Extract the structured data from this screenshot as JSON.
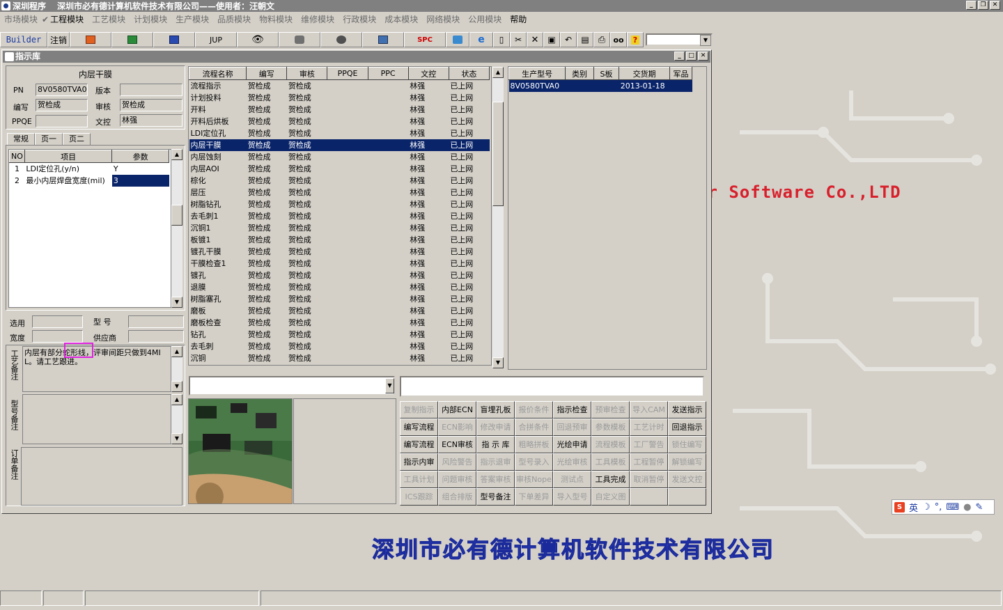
{
  "app": {
    "title": "深圳程序",
    "company_title": "深圳市必有德计算机软件技术有限公司——使用者：汪朝文"
  },
  "menu": [
    {
      "label": "市场模块",
      "active": false
    },
    {
      "label": "工程模块",
      "active": true
    },
    {
      "label": "工艺模块",
      "active": false
    },
    {
      "label": "计划模块",
      "active": false
    },
    {
      "label": "生产模块",
      "active": false
    },
    {
      "label": "品质模块",
      "active": false
    },
    {
      "label": "物料模块",
      "active": false
    },
    {
      "label": "维修模块",
      "active": false
    },
    {
      "label": "行政模块",
      "active": false
    },
    {
      "label": "成本模块",
      "active": false
    },
    {
      "label": "网络模块",
      "active": false
    },
    {
      "label": "公用模块",
      "active": false
    },
    {
      "label": "帮助",
      "active": true
    }
  ],
  "toolbar": {
    "builder": "Builder",
    "logout": "注销",
    "jup": "JUP",
    "spc": "SPC"
  },
  "desktop": {
    "watermark": "er Software Co.,LTD",
    "company": "深圳市必有德计算机软件技术有限公司"
  },
  "ime": {
    "label": "英"
  },
  "window": {
    "title": "指示库"
  },
  "left": {
    "section_title": "内层干膜",
    "pn_label": "PN",
    "pn_value": "8V0580TVA0",
    "version_label": "版本",
    "version_value": "",
    "author_label": "编写",
    "author_value": "贺检成",
    "reviewer_label": "审核",
    "reviewer_value": "贺检成",
    "ppqe_label": "PPQE",
    "ppqe_value": "",
    "doc_label": "文控",
    "doc_value": "林强",
    "tabs": [
      "常规",
      "页一",
      "页二"
    ],
    "param_headers": [
      "NO",
      "项目",
      "参数"
    ],
    "params": [
      {
        "no": "1",
        "item": "LDI定位孔(y/n)",
        "value": "Y"
      },
      {
        "no": "2",
        "item": "最小内层焊盘宽度(mil)",
        "value": "3"
      }
    ],
    "select_label": "选用",
    "model_label": "型 号",
    "width_label": "宽度",
    "supplier_label": "供应商",
    "process_note_label": "工艺备注",
    "process_note": "内层有部分蛇形线，评审间距只做到4MIL。请工艺跟进。",
    "model_note_label": "型号备注",
    "order_note_label": "订单备注"
  },
  "process_table": {
    "headers": [
      "流程名称",
      "编写",
      "审核",
      "PPQE",
      "PPC",
      "文控",
      "状态"
    ],
    "rows": [
      {
        "name": "流程指示",
        "author": "贺检成",
        "reviewer": "贺检成",
        "ppqe": "",
        "ppc": "",
        "doc": "林强",
        "status": "已上网"
      },
      {
        "name": "计划投料",
        "author": "贺检成",
        "reviewer": "贺检成",
        "ppqe": "",
        "ppc": "",
        "doc": "林强",
        "status": "已上网"
      },
      {
        "name": "开料",
        "author": "贺检成",
        "reviewer": "贺检成",
        "ppqe": "",
        "ppc": "",
        "doc": "林强",
        "status": "已上网"
      },
      {
        "name": "开料后烘板",
        "author": "贺检成",
        "reviewer": "贺检成",
        "ppqe": "",
        "ppc": "",
        "doc": "林强",
        "status": "已上网"
      },
      {
        "name": "LDI定位孔",
        "author": "贺检成",
        "reviewer": "贺检成",
        "ppqe": "",
        "ppc": "",
        "doc": "林强",
        "status": "已上网"
      },
      {
        "name": "内层干膜",
        "author": "贺检成",
        "reviewer": "贺检成",
        "ppqe": "",
        "ppc": "",
        "doc": "林强",
        "status": "已上网",
        "selected": true
      },
      {
        "name": "内层蚀刻",
        "author": "贺检成",
        "reviewer": "贺检成",
        "ppqe": "",
        "ppc": "",
        "doc": "林强",
        "status": "已上网"
      },
      {
        "name": "内层AOI",
        "author": "贺检成",
        "reviewer": "贺检成",
        "ppqe": "",
        "ppc": "",
        "doc": "林强",
        "status": "已上网"
      },
      {
        "name": "棕化",
        "author": "贺检成",
        "reviewer": "贺检成",
        "ppqe": "",
        "ppc": "",
        "doc": "林强",
        "status": "已上网"
      },
      {
        "name": "层压",
        "author": "贺检成",
        "reviewer": "贺检成",
        "ppqe": "",
        "ppc": "",
        "doc": "林强",
        "status": "已上网"
      },
      {
        "name": "树脂钻孔",
        "author": "贺检成",
        "reviewer": "贺检成",
        "ppqe": "",
        "ppc": "",
        "doc": "林强",
        "status": "已上网"
      },
      {
        "name": "去毛刺1",
        "author": "贺检成",
        "reviewer": "贺检成",
        "ppqe": "",
        "ppc": "",
        "doc": "林强",
        "status": "已上网"
      },
      {
        "name": "沉铜1",
        "author": "贺检成",
        "reviewer": "贺检成",
        "ppqe": "",
        "ppc": "",
        "doc": "林强",
        "status": "已上网"
      },
      {
        "name": "板镀1",
        "author": "贺检成",
        "reviewer": "贺检成",
        "ppqe": "",
        "ppc": "",
        "doc": "林强",
        "status": "已上网"
      },
      {
        "name": "镀孔干膜",
        "author": "贺检成",
        "reviewer": "贺检成",
        "ppqe": "",
        "ppc": "",
        "doc": "林强",
        "status": "已上网"
      },
      {
        "name": "干膜检查1",
        "author": "贺检成",
        "reviewer": "贺检成",
        "ppqe": "",
        "ppc": "",
        "doc": "林强",
        "status": "已上网"
      },
      {
        "name": "镀孔",
        "author": "贺检成",
        "reviewer": "贺检成",
        "ppqe": "",
        "ppc": "",
        "doc": "林强",
        "status": "已上网"
      },
      {
        "name": "退膜",
        "author": "贺检成",
        "reviewer": "贺检成",
        "ppqe": "",
        "ppc": "",
        "doc": "林强",
        "status": "已上网"
      },
      {
        "name": "树脂塞孔",
        "author": "贺检成",
        "reviewer": "贺检成",
        "ppqe": "",
        "ppc": "",
        "doc": "林强",
        "status": "已上网"
      },
      {
        "name": "磨板",
        "author": "贺检成",
        "reviewer": "贺检成",
        "ppqe": "",
        "ppc": "",
        "doc": "林强",
        "status": "已上网"
      },
      {
        "name": "磨板检查",
        "author": "贺检成",
        "reviewer": "贺检成",
        "ppqe": "",
        "ppc": "",
        "doc": "林强",
        "status": "已上网"
      },
      {
        "name": "钻孔",
        "author": "贺检成",
        "reviewer": "贺检成",
        "ppqe": "",
        "ppc": "",
        "doc": "林强",
        "status": "已上网"
      },
      {
        "name": "去毛刺",
        "author": "贺检成",
        "reviewer": "贺检成",
        "ppqe": "",
        "ppc": "",
        "doc": "林强",
        "status": "已上网"
      },
      {
        "name": "沉铜",
        "author": "贺检成",
        "reviewer": "贺检成",
        "ppqe": "",
        "ppc": "",
        "doc": "林强",
        "status": "已上网"
      }
    ]
  },
  "model_table": {
    "headers": [
      "生产型号",
      "类别",
      "S板",
      "交货期",
      "军品"
    ],
    "rows": [
      {
        "model": "8V0580TVA0",
        "category": "",
        "s": "",
        "due": "2013-01-18",
        "military": ""
      }
    ]
  },
  "buttons": [
    {
      "label": "复制指示",
      "enabled": false
    },
    {
      "label": "内部ECN",
      "enabled": true
    },
    {
      "label": "盲埋孔板",
      "enabled": true
    },
    {
      "label": "报价条件",
      "enabled": false
    },
    {
      "label": "指示检查",
      "enabled": true
    },
    {
      "label": "预审检查",
      "enabled": false
    },
    {
      "label": "导入CAM",
      "enabled": false
    },
    {
      "label": "发送指示",
      "enabled": true
    },
    {
      "label": "编写流程",
      "enabled": true
    },
    {
      "label": "ECN影响",
      "enabled": false
    },
    {
      "label": "修改申请",
      "enabled": false
    },
    {
      "label": "合拼条件",
      "enabled": false
    },
    {
      "label": "回退预审",
      "enabled": false
    },
    {
      "label": "参数模板",
      "enabled": false
    },
    {
      "label": "工艺计时",
      "enabled": false
    },
    {
      "label": "回退指示",
      "enabled": true
    },
    {
      "label": "编写流程",
      "enabled": true
    },
    {
      "label": "ECN审核",
      "enabled": true
    },
    {
      "label": "指 示 库",
      "enabled": true
    },
    {
      "label": "粗略拼板",
      "enabled": false
    },
    {
      "label": "光绘申请",
      "enabled": true
    },
    {
      "label": "流程模板",
      "enabled": false
    },
    {
      "label": "工厂警告",
      "enabled": false
    },
    {
      "label": "锁住编写",
      "enabled": false
    },
    {
      "label": "指示内审",
      "enabled": true
    },
    {
      "label": "风险警告",
      "enabled": false
    },
    {
      "label": "指示退审",
      "enabled": false
    },
    {
      "label": "型号录入",
      "enabled": false
    },
    {
      "label": "光绘审核",
      "enabled": false
    },
    {
      "label": "工具模板",
      "enabled": false
    },
    {
      "label": "工程暂停",
      "enabled": false
    },
    {
      "label": "解锁编写",
      "enabled": false
    },
    {
      "label": "工具计划",
      "enabled": false
    },
    {
      "label": "问题审核",
      "enabled": false
    },
    {
      "label": "答案审核",
      "enabled": false
    },
    {
      "label": "审核Nope",
      "enabled": false
    },
    {
      "label": "测试点",
      "enabled": false
    },
    {
      "label": "工具完成",
      "enabled": true
    },
    {
      "label": "取消暂停",
      "enabled": false
    },
    {
      "label": "发送文控",
      "enabled": false
    },
    {
      "label": "ICS跟踪",
      "enabled": false
    },
    {
      "label": "组合排版",
      "enabled": false
    },
    {
      "label": "型号备注",
      "enabled": true
    },
    {
      "label": "下单差异",
      "enabled": false
    },
    {
      "label": "导入型号",
      "enabled": false
    },
    {
      "label": "自定义图",
      "enabled": false
    },
    {
      "label": "",
      "enabled": false
    },
    {
      "label": "",
      "enabled": false
    }
  ]
}
